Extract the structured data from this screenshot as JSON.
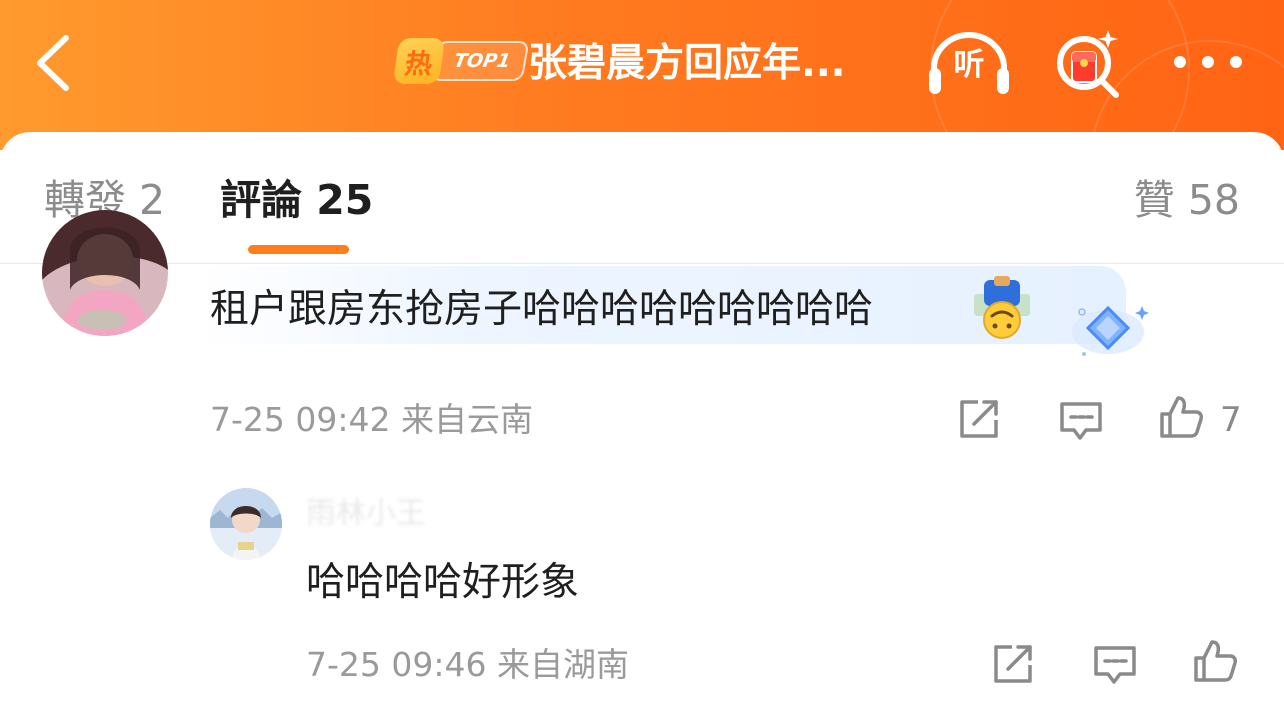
{
  "header": {
    "hot_badge_char": "热",
    "hot_rank_label": "TOP1",
    "title": "张碧晨方回应年...",
    "listen_label": "听",
    "icons": {
      "back": "back-arrow-icon",
      "listen": "headphones-icon",
      "search": "search-icon",
      "more": "more-dots-icon"
    }
  },
  "tabs": {
    "repost": "轉發 2",
    "comments": "評論 25",
    "likes": "贊 58",
    "active": "comments",
    "accent_color": "#ff7e1c"
  },
  "comments": [
    {
      "text": "租户跟房东抢房子哈哈哈哈哈哈哈哈哈",
      "emoji": "upside-down-face-emoji",
      "meta": "7-25 09:42 来自云南",
      "like_count": "7"
    }
  ],
  "replies": [
    {
      "username": "雨林小王",
      "text": "哈哈哈哈好形象",
      "meta": "7-25 09:46 来自湖南"
    }
  ],
  "colors": {
    "header_gradient_start": "#ff9a2e",
    "header_gradient_end": "#ff6414",
    "hot_badge": "#ffc43a",
    "text_primary": "#1f1f1f",
    "text_secondary": "#9a9a9a"
  }
}
